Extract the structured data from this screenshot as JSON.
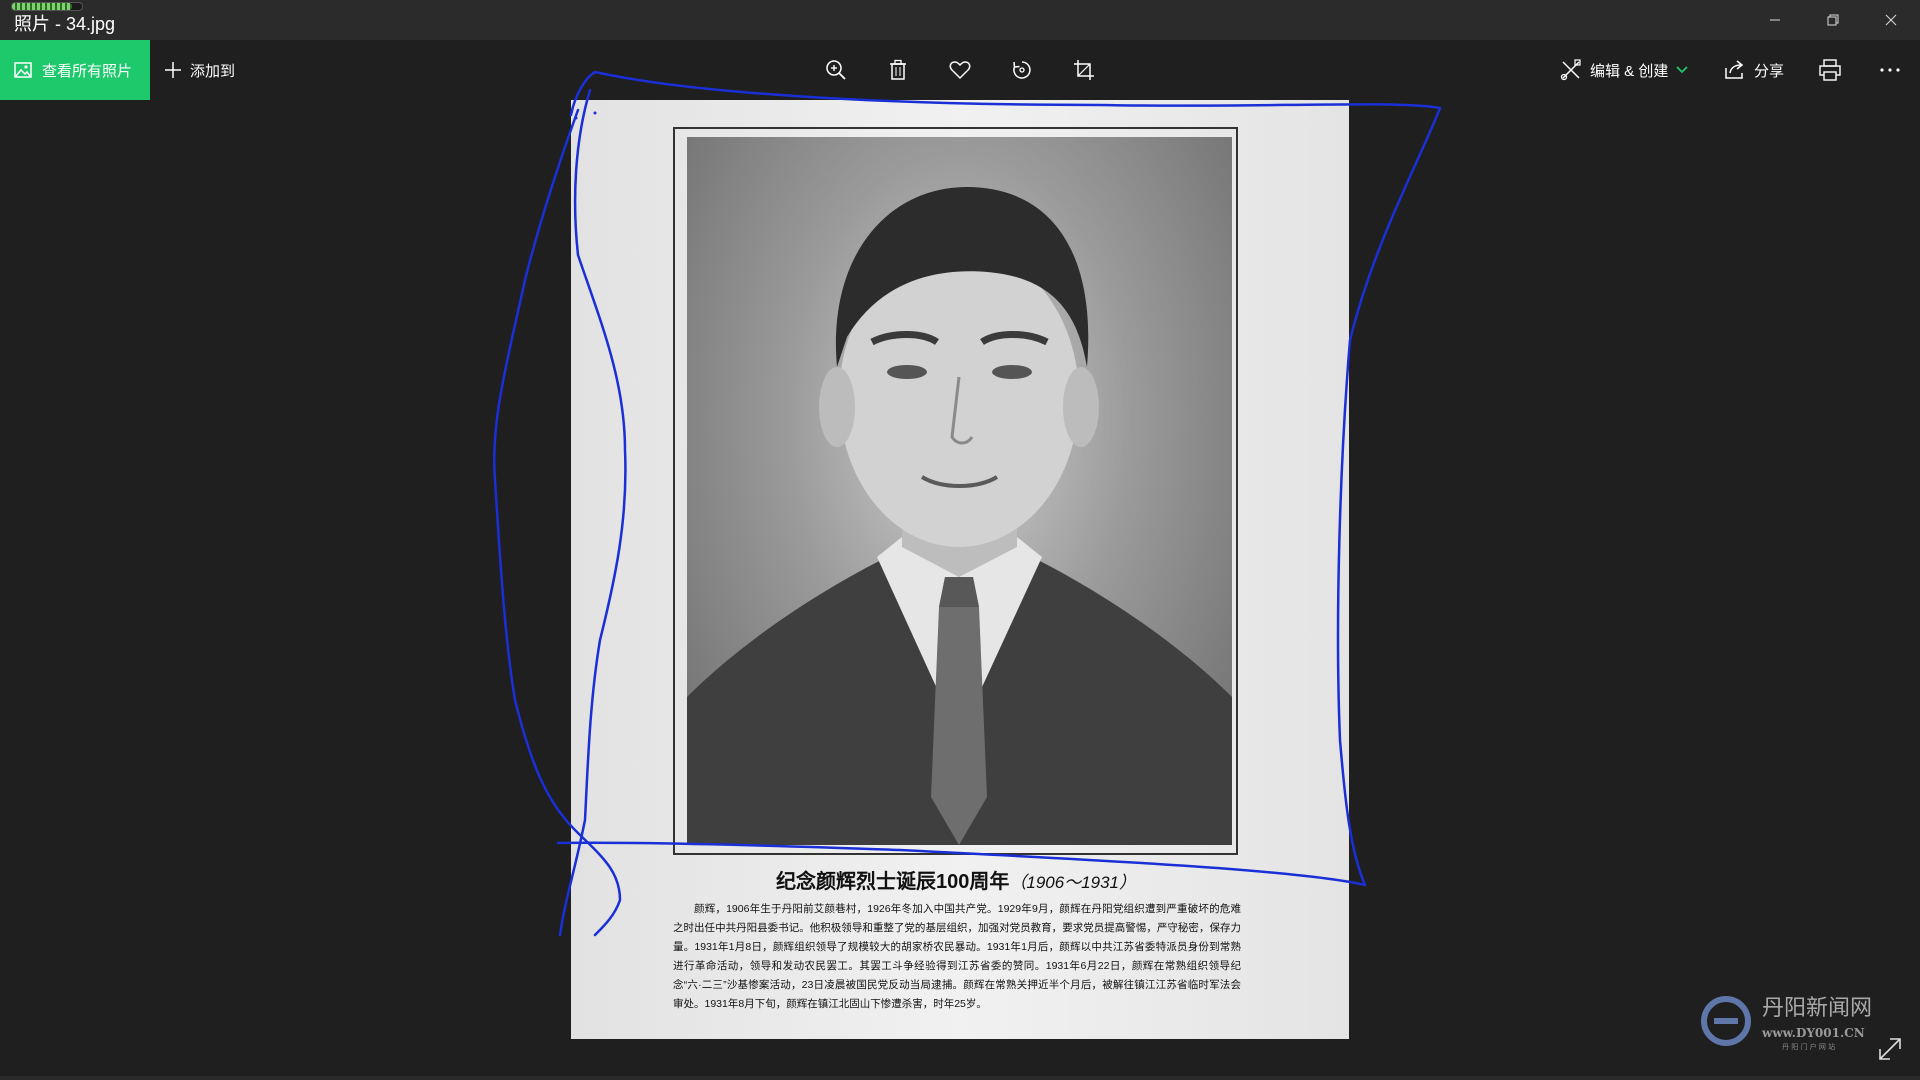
{
  "window": {
    "title": "照片 - 34.jpg",
    "progress": 0.85
  },
  "toolbar": {
    "view_all_label": "查看所有照片",
    "add_to_label": "添加到",
    "edit_create_label": "编辑 & 创建",
    "share_label": "分享",
    "icons": {
      "zoom": "zoom-in-icon",
      "delete": "trash-icon",
      "favorite": "heart-icon",
      "rotate": "rotate-icon",
      "crop": "crop-icon",
      "print": "print-icon",
      "more": "more-icon"
    }
  },
  "photo": {
    "caption_title": "纪念颜辉烈士诞辰100周年",
    "caption_years": "（1906～1931）",
    "caption_body": "颜辉，1906年生于丹阳前艾颜巷村，1926年冬加入中国共产党。1929年9月，颜辉在丹阳党组织遭到严重破坏的危难之时出任中共丹阳县委书记。他积极领导和重整了党的基层组织，加强对党员教育，要求党员提高警惕，严守秘密，保存力量。1931年1月8日，颜辉组织领导了规模较大的胡家桥农民暴动。1931年1月后，颜辉以中共江苏省委特派员身份到常熟进行革命活动，领导和发动农民罢工。其罢工斗争经验得到江苏省委的赞同。1931年6月22日，颜辉在常熟组织领导纪念“六·二三”沙基惨案活动，23日凌晨被国民党反动当局逮捕。颜辉在常熟关押近半个月后，被解往镇江江苏省临时军法会审处。1931年8月下旬，颜辉在镇江北固山下惨遭杀害，时年25岁。"
  },
  "watermark": {
    "brand": "丹阳新闻网",
    "domain": "www.DY001.CN",
    "tagline": "丹 阳 门 户 网 站"
  },
  "colors": {
    "accent": "#1ec96c",
    "ink": "#1a2fd6"
  }
}
